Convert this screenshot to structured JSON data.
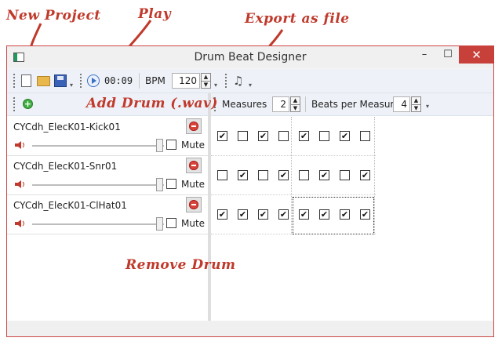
{
  "annotations": {
    "new_project": "New Project",
    "play": "Play",
    "export": "Export as file",
    "add_drum": "Add Drum (.wav)",
    "remove_drum": "Remove Drum"
  },
  "window": {
    "title": "Drum Beat Designer",
    "min": "–",
    "max": "☐",
    "close": "✕"
  },
  "toolbar": {
    "time": "00:09",
    "bpm_label": "BPM",
    "bpm_value": "120"
  },
  "settings": {
    "measures_label": "Measures",
    "measures_value": "2",
    "beats_label": "Beats per Measure",
    "beats_value": "4"
  },
  "drums": [
    {
      "name": "CYCdh_ElecK01-Kick01",
      "mute_label": "Mute",
      "pattern": [
        true,
        false,
        true,
        false,
        true,
        false,
        true,
        false
      ]
    },
    {
      "name": "CYCdh_ElecK01-Snr01",
      "mute_label": "Mute",
      "pattern": [
        false,
        true,
        false,
        true,
        false,
        true,
        false,
        true
      ]
    },
    {
      "name": "CYCdh_ElecK01-ClHat01",
      "mute_label": "Mute",
      "pattern": [
        true,
        true,
        true,
        true,
        true,
        true,
        true,
        true
      ]
    }
  ],
  "colors": {
    "accent_red": "#c0392b",
    "toolbar_bg": "#eef2f8",
    "close_button": "#c7403a"
  }
}
